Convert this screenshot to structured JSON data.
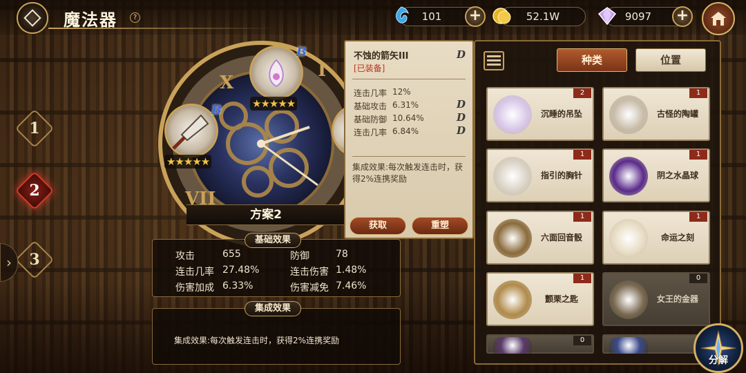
{
  "header": {
    "title": "魔法器",
    "help_icon": "question-circle-icon"
  },
  "resources": [
    {
      "name": "blue-crystal",
      "icon": "blue-wisp-icon",
      "value": "101",
      "has_plus": true
    },
    {
      "name": "gold",
      "icon": "gold-coin-icon",
      "value": "52.1W",
      "has_plus": false
    },
    {
      "name": "gem",
      "icon": "purple-gem-icon",
      "value": "9097",
      "has_plus": true
    }
  ],
  "home_icon": "house-icon",
  "side_slots": [
    "1",
    "2",
    "3"
  ],
  "active_slot": "2",
  "clock": {
    "plan_label": "方案2",
    "slot_gem_grade": "B",
    "stars": "★★★★★"
  },
  "base_stats": {
    "tag": "基础效果",
    "rows": [
      [
        {
          "label": "攻击",
          "value": "655"
        },
        {
          "label": "防御",
          "value": "78"
        }
      ],
      [
        {
          "label": "连击几率",
          "value": "27.48%"
        },
        {
          "label": "连击伤害",
          "value": "1.48%"
        }
      ],
      [
        {
          "label": "伤害加成",
          "value": "6.33%"
        },
        {
          "label": "伤害减免",
          "value": "7.46%"
        }
      ]
    ]
  },
  "set_effect": {
    "tag": "集成效果",
    "text": "集成效果:每次触发连击时，获得2%连携奖励"
  },
  "tooltip": {
    "name": "不蚀的箭矢III",
    "grade": "D",
    "equipped": "[已装备]",
    "main_stat": {
      "label": "连击几率",
      "value": "12%"
    },
    "sub_stats": [
      {
        "label": "基础攻击",
        "value": "6.31%",
        "grade": "D"
      },
      {
        "label": "基础防御",
        "value": "10.64%",
        "grade": "D"
      },
      {
        "label": "连击几率",
        "value": "6.84%",
        "grade": "D"
      }
    ],
    "set_text": "集成效果:每次触发连击时，获得2%连携奖励",
    "btn_obtain": "获取",
    "btn_reforge": "重塑"
  },
  "inventory": {
    "tab_type": "种类",
    "tab_position": "位置",
    "items": [
      {
        "name": "沉睡的吊坠",
        "count": "2",
        "owned": true,
        "icon": "pendant-icon",
        "color": "#d8c6e8"
      },
      {
        "name": "古怪的陶罐",
        "count": "1",
        "owned": true,
        "icon": "urn-icon",
        "color": "#c8bca8"
      },
      {
        "name": "指引的胸针",
        "count": "1",
        "owned": true,
        "icon": "brooch-icon",
        "color": "#d9d2c4"
      },
      {
        "name": "阴之水晶球",
        "count": "1",
        "owned": true,
        "icon": "crystal-ball-icon",
        "color": "#5a2a8a"
      },
      {
        "name": "六面回音骰",
        "count": "1",
        "owned": true,
        "icon": "dice-icon",
        "color": "#8a6a3a"
      },
      {
        "name": "命运之刻",
        "count": "1",
        "owned": true,
        "icon": "pocket-watch-icon",
        "color": "#e8dcc4"
      },
      {
        "name": "颤栗之匙",
        "count": "1",
        "owned": true,
        "icon": "key-icon",
        "color": "#b08a4a"
      },
      {
        "name": "女王的金器",
        "count": "0",
        "owned": false,
        "icon": "goblet-icon",
        "color": "#7a6a52"
      },
      {
        "name": "",
        "count": "0",
        "owned": false,
        "icon": "book-icon",
        "color": "#5a3a6a"
      },
      {
        "name": "",
        "count": "",
        "owned": false,
        "icon": "orb-icon",
        "color": "#3a4a8a"
      }
    ]
  },
  "break_button": {
    "label": "分解",
    "icon": "compass-icon"
  }
}
